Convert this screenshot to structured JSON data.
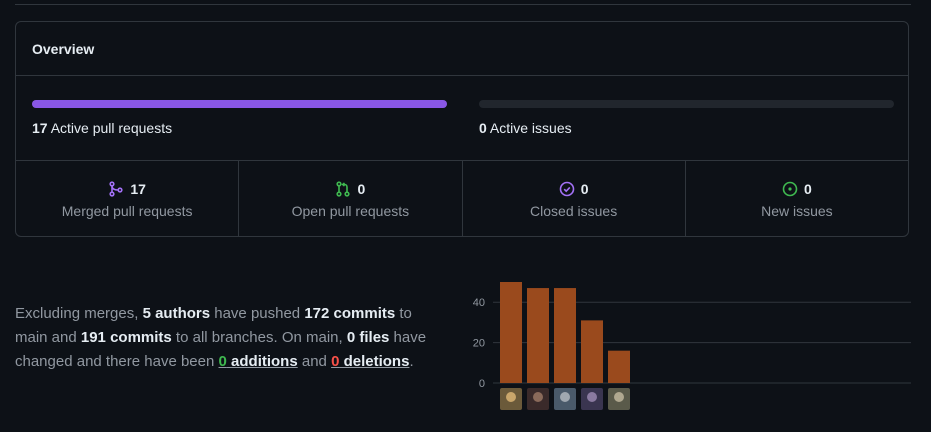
{
  "overview": {
    "title": "Overview",
    "pull_requests": {
      "count": "17",
      "label": "Active pull requests",
      "fill_fraction": 1.0
    },
    "issues": {
      "count": "0",
      "label": "Active issues",
      "fill_fraction": 0.0
    },
    "stats": [
      {
        "icon": "git-merge-icon",
        "count": "17",
        "label": "Merged pull requests",
        "color": "#a371f7"
      },
      {
        "icon": "git-pull-request-icon",
        "count": "0",
        "label": "Open pull requests",
        "color": "#3fb950"
      },
      {
        "icon": "issue-closed-icon",
        "count": "0",
        "label": "Closed issues",
        "color": "#a371f7"
      },
      {
        "icon": "issue-opened-icon",
        "count": "0",
        "label": "New issues",
        "color": "#3fb950"
      }
    ],
    "accent_color": "#8957e5"
  },
  "summary": {
    "t1": "Excluding merges, ",
    "authors": "5 authors",
    "t2": " have pushed ",
    "commits_main": "172 commits",
    "t3": " to main and ",
    "commits_all": "191 commits",
    "t4": " to all branches. On main, ",
    "files": "0 files",
    "t5": " have changed and there have been ",
    "additions_count": "0",
    "additions_word": " additions",
    "t6": " and ",
    "deletions_count": "0",
    "deletions_word": " deletions",
    "t7": "."
  },
  "chart_data": {
    "type": "bar",
    "categories": [
      "author-1",
      "author-2",
      "author-3",
      "author-4",
      "author-5"
    ],
    "values": [
      50,
      47,
      47,
      31,
      16
    ],
    "yticks": [
      0,
      20,
      40
    ],
    "ylim": [
      0,
      50
    ],
    "grid": true,
    "bar_color": "#9a4a1d",
    "title": "",
    "xlabel": "",
    "ylabel": ""
  }
}
